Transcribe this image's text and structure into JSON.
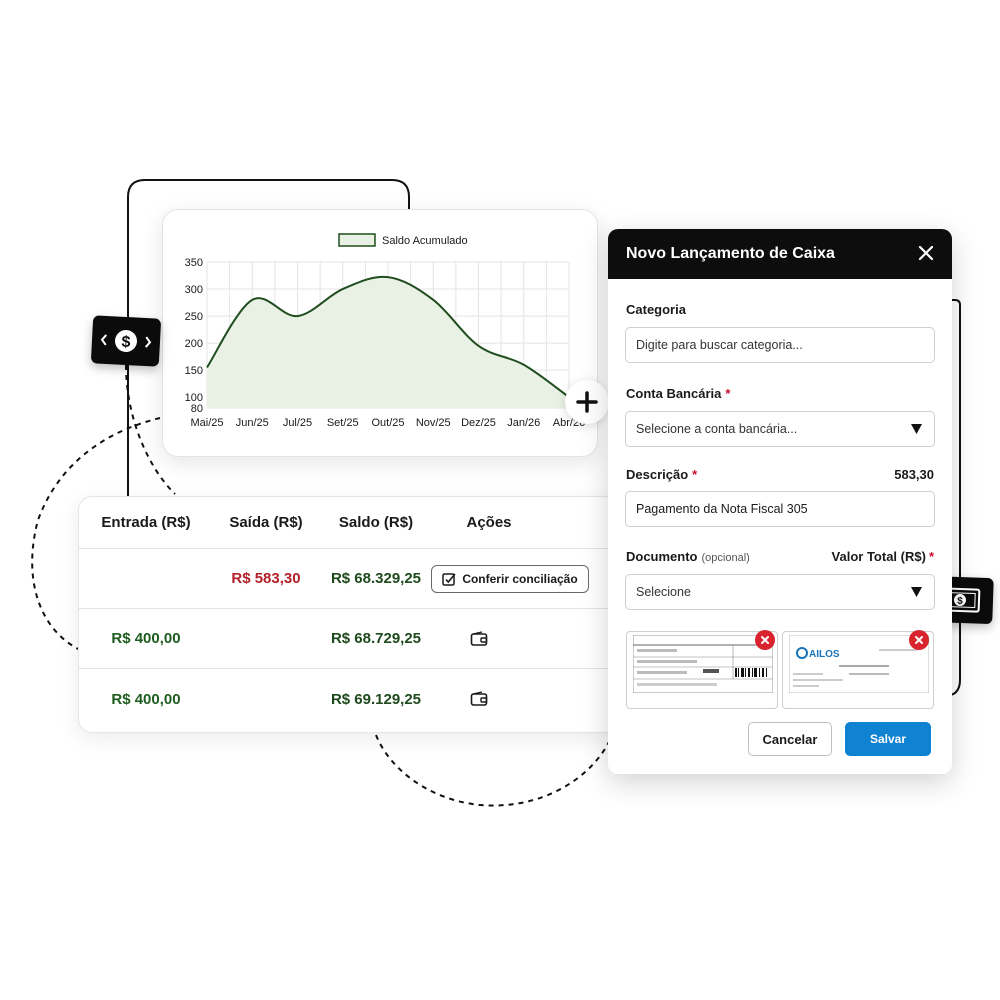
{
  "chart": {
    "legend_label": "Saldo Acumulado",
    "line_color": "#1e4d1e",
    "fill_color": "#e9f1e5"
  },
  "chart_data": {
    "type": "area",
    "categories": [
      "Mai/25",
      "Jun/25",
      "Jul/25",
      "Set/25",
      "Out/25",
      "Nov/25",
      "Dez/25",
      "Jan/26",
      "Abr/26"
    ],
    "series": [
      {
        "name": "Saldo Acumulado",
        "values": [
          155,
          280,
          250,
          300,
          322,
          280,
          195,
          160,
          100
        ]
      }
    ],
    "y_ticks": [
      80,
      100,
      150,
      200,
      250,
      300,
      350
    ],
    "ylim": [
      80,
      350
    ],
    "grid": true,
    "legend_position": "top-center"
  },
  "table": {
    "headers": [
      "Entrada (R$)",
      "Saída (R$)",
      "Saldo (R$)",
      "Ações"
    ],
    "rows": [
      {
        "entrada": "",
        "saida": "R$ 583,30",
        "saldo": "R$ 68.329,25",
        "action": "Conferir conciliação"
      },
      {
        "entrada": "R$ 400,00",
        "saida": "",
        "saldo": "R$ 68.729,25",
        "action_icon": "wallet-icon"
      },
      {
        "entrada": "R$ 400,00",
        "saida": "",
        "saldo": "R$ 69.129,25",
        "action_icon": "wallet-icon"
      }
    ]
  },
  "modal": {
    "title": "Novo Lançamento de Caixa",
    "categoria": {
      "label": "Categoria",
      "placeholder": "Digite para buscar categoria..."
    },
    "conta": {
      "label": "Conta Bancária",
      "required_mark": "*",
      "placeholder": "Selecione a conta bancária..."
    },
    "descricao": {
      "label": "Descrição",
      "required_mark": "*",
      "value": "Pagamento da Nota Fiscal 305",
      "amount": "583,30"
    },
    "documento": {
      "label": "Documento",
      "optional": "(opcional)",
      "placeholder": "Selecione"
    },
    "valor_total": {
      "label": "Valor Total (R$)",
      "required_mark": "*"
    },
    "attachments": [
      {
        "type": "boleto"
      },
      {
        "type": "invoice",
        "brand": "AILOS"
      }
    ],
    "cancel_label": "Cancelar",
    "save_label": "Salvar"
  },
  "colors": {
    "positive": "#1f5c1f",
    "negative": "#b3202a",
    "primary": "#0f83d2",
    "header_bg": "#0d0d0d"
  }
}
